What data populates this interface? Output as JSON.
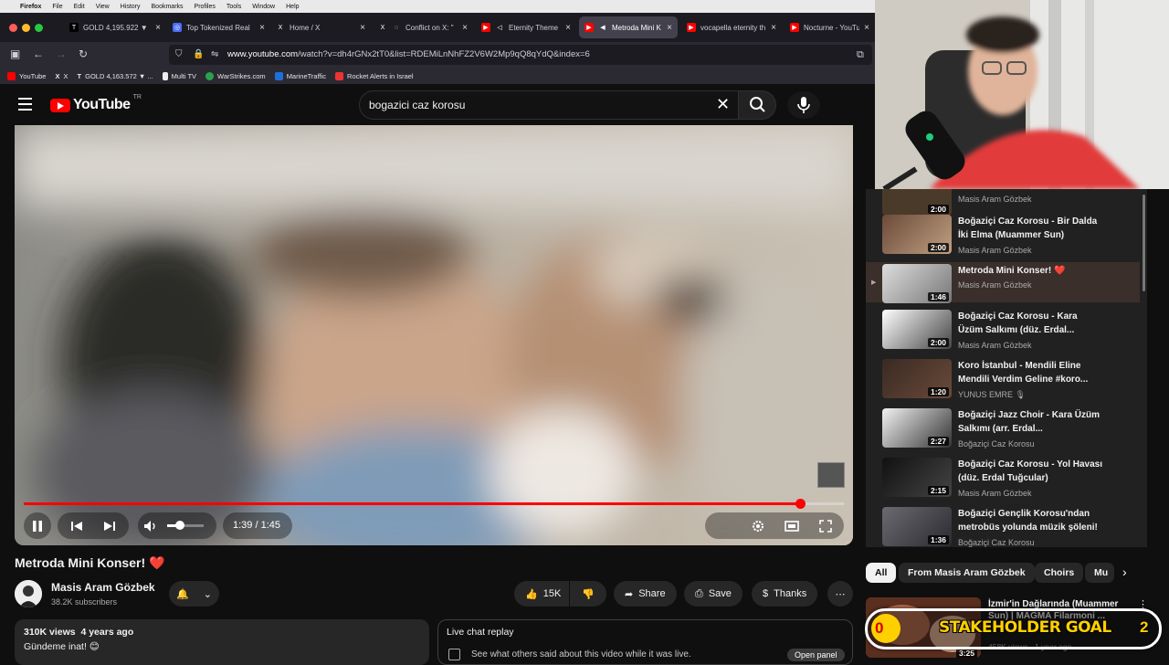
{
  "menubar": {
    "app": "Firefox",
    "items": [
      "File",
      "Edit",
      "View",
      "History",
      "Bookmarks",
      "Profiles",
      "Tools",
      "Window",
      "Help"
    ]
  },
  "tabs": [
    {
      "title": "GOLD 4,195.922 ▼",
      "active": false
    },
    {
      "title": "Top Tokenized Real",
      "active": false
    },
    {
      "title": "Home / X",
      "active": false
    },
    {
      "title": "Conflict on X: \"",
      "active": false
    },
    {
      "title": "Eternity Theme",
      "active": false
    },
    {
      "title": "Metroda Mini K",
      "active": true
    },
    {
      "title": "vocapella eternity th",
      "active": false
    },
    {
      "title": "Nocturne - YouTube",
      "active": false
    }
  ],
  "address": {
    "host": "www.youtube.com",
    "path": "/watch?v=dh4rGNx2tT0&list=RDEMiLnNhFZ2V6W2Mp9qQ8qYdQ&index=6"
  },
  "bookmarks": [
    "YouTube",
    "X",
    "GOLD 4,163.572 ▼ ...",
    "Multi TV",
    "WarStrikes.com",
    "MarineTraffic",
    "Rocket Alerts in Israel"
  ],
  "header": {
    "logo": "YouTube",
    "country": "TR",
    "search_value": "bogazici caz korosu"
  },
  "player": {
    "time": "1:39 / 1:45",
    "progress": 0.943
  },
  "video": {
    "title": "Metroda Mini Konser!",
    "title_emoji": "❤️",
    "channel": "Masis Aram Gözbek",
    "subscribers": "38.2K subscribers",
    "likes": "15K",
    "share": "Share",
    "save": "Save",
    "thanks": "Thanks",
    "views_line": "310K views  4 years ago",
    "description": "Gündeme inat! 😊"
  },
  "chat": {
    "title": "Live chat replay",
    "subtitle": "See what others said about this video while it was live.",
    "button": "Open panel"
  },
  "playlist": [
    {
      "title": "",
      "channel": "Masis Aram Gözbek",
      "duration": "2:00",
      "current": false
    },
    {
      "title": "Boğaziçi Caz Korosu - Bir Dalda İki Elma (Muammer Sun)",
      "channel": "Masis Aram Gözbek",
      "duration": "2:00",
      "current": false
    },
    {
      "title": "Metroda Mini Konser! ❤️",
      "channel": "Masis Aram Gözbek",
      "duration": "1:46",
      "current": true
    },
    {
      "title": "Boğaziçi Caz Korosu - Kara Üzüm Salkımı (düz. Erdal...",
      "channel": "Masis Aram Gözbek",
      "duration": "2:00",
      "current": false
    },
    {
      "title": "Koro İstanbul - Mendili Eline Mendili Verdim Geline #koro...",
      "channel": "YUNUS EMRE 🎙",
      "duration": "1:20",
      "current": false
    },
    {
      "title": "Boğaziçi Jazz Choir - Kara Üzüm Salkımı (arr. Erdal...",
      "channel": "Boğaziçi Caz Korosu",
      "duration": "2:27",
      "current": false
    },
    {
      "title": "Boğaziçi Caz Korosu - Yol Havası (düz. Erdal Tuğcular)",
      "channel": "Masis Aram Gözbek",
      "duration": "2:15",
      "current": false
    },
    {
      "title": "Boğaziçi Gençlik Korosu'ndan metrobüs yolunda müzik şöleni!",
      "channel": "Boğaziçi Caz Korosu",
      "duration": "1:36",
      "current": false
    }
  ],
  "chips": [
    "All",
    "From Masis Aram Gözbek",
    "Choirs",
    "Mu"
  ],
  "recommended": {
    "title": "İzmir'in Dağlarında (Muammer Sun) | MAGMA Filarmoni ...",
    "meta": "458K views · 1 year ago",
    "duration": "3:25"
  },
  "overlay": {
    "current": "0",
    "label": "STAKEHOLDER GOAL",
    "target": "2"
  },
  "colors": {
    "youtube_red": "#ff0000",
    "background": "#0f0f0f",
    "goal_yellow": "#ffd000"
  }
}
